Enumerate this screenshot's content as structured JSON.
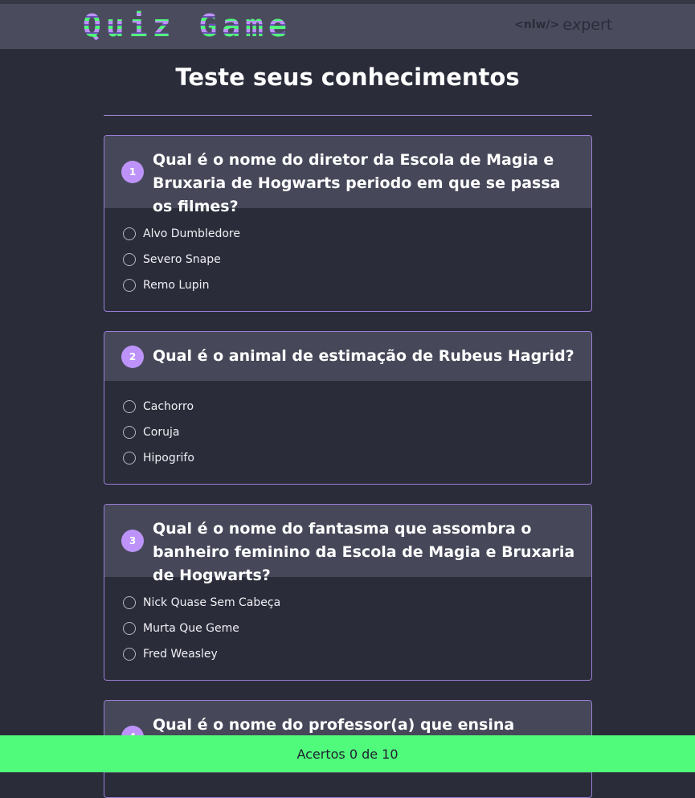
{
  "header": {
    "logo_text": "Quiz Game",
    "brand_tag": "<nlw/>",
    "brand_word_a": "e",
    "brand_word_x": "x",
    "brand_word_b": "pert"
  },
  "page_title": "Teste seus conhecimentos",
  "questions": [
    {
      "number": "1",
      "text": "Qual é o nome do diretor da Escola de Magia e Bruxaria de Hogwarts periodo em que se passa os filmes?",
      "options": [
        "Alvo Dumbledore",
        "Severo Snape",
        "Remo Lupin"
      ]
    },
    {
      "number": "2",
      "text": "Qual é o animal de estimação de Rubeus Hagrid?",
      "options": [
        "Cachorro",
        "Coruja",
        "Hipogrifo"
      ]
    },
    {
      "number": "3",
      "text": "Qual é o nome do fantasma que assombra o banheiro feminino da Escola de Magia e Bruxaria de Hogwarts?",
      "options": [
        "Nick Quase Sem Cabeça",
        "Murta Que Geme",
        "Fred Weasley"
      ]
    },
    {
      "number": "4",
      "text": "Qual é o nome do professor(a) que ensina"
    }
  ],
  "footer": {
    "score_text": "Acertos 0 de 10"
  },
  "colors": {
    "accent_purple": "#bd93f9",
    "accent_green": "#50fa7b",
    "background": "#2a2c39",
    "header_bg": "#4a4c5e"
  }
}
